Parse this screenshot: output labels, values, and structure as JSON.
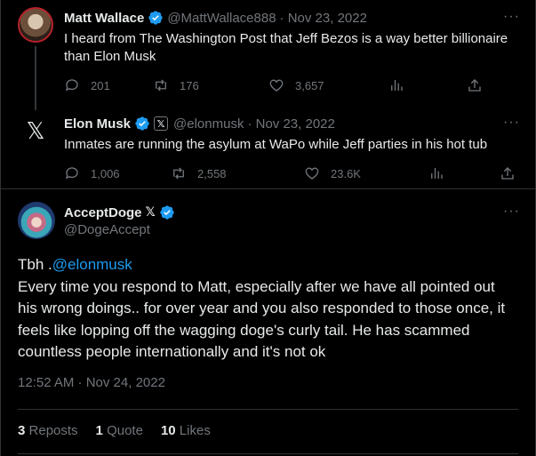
{
  "thread": [
    {
      "name": "Matt Wallace",
      "handle": "@MattWallace888",
      "date": "· Nov 23, 2022",
      "text": "I heard from The Washington Post that Jeff Bezos is a way better billionaire than Elon Musk",
      "replies": "201",
      "reposts": "176",
      "likes": "3,657"
    },
    {
      "name": "Elon Musk",
      "handle": "@elonmusk",
      "date": "· Nov 23, 2022",
      "text": "Inmates are running the asylum at WaPo while Jeff parties in his hot tub",
      "replies": "1,006",
      "reposts": "2,558",
      "likes": "23.6K"
    }
  ],
  "main": {
    "name": "AcceptDoge",
    "name_badge": "𝕏",
    "handle": "@DogeAccept",
    "text_prefix": "Tbh .",
    "mention": "@elonmusk",
    "text_body": "Every time you respond to Matt, especially after we have all pointed out his wrong doings.. for over year and you also responded to those once, it feels like lopping off the wagging doge's curly tail. He has scammed countless people internationally and it's not ok",
    "timestamp": "12:52 AM · Nov 24, 2022",
    "stats": [
      {
        "count": "3",
        "label": "Reposts"
      },
      {
        "count": "1",
        "label": "Quote"
      },
      {
        "count": "10",
        "label": "Likes"
      }
    ]
  },
  "icons": {
    "more": "···",
    "x_logo": "𝕏",
    "x_badge": "𝕏"
  },
  "colors": {
    "background": "#000000",
    "text": "#e7e9ea",
    "muted": "#71767b",
    "link": "#1d9bf0",
    "verified": "#1d9bf0"
  }
}
